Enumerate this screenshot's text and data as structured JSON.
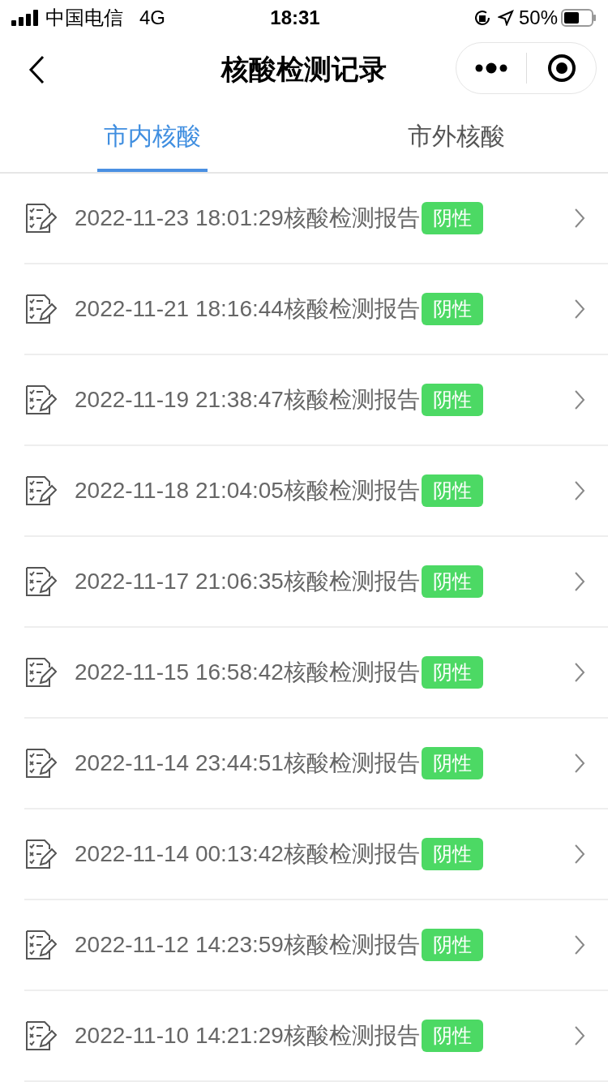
{
  "status_bar": {
    "carrier": "中国电信",
    "network": "4G",
    "time": "18:31",
    "battery": "50%"
  },
  "nav": {
    "title": "核酸检测记录"
  },
  "tabs": [
    {
      "label": "市内核酸",
      "selected": true
    },
    {
      "label": "市外核酸",
      "selected": false
    }
  ],
  "records": [
    {
      "title": "2022-11-23 18:01:29核酸检测报告",
      "result": "阴性"
    },
    {
      "title": "2022-11-21 18:16:44核酸检测报告",
      "result": "阴性"
    },
    {
      "title": "2022-11-19 21:38:47核酸检测报告",
      "result": "阴性"
    },
    {
      "title": "2022-11-18 21:04:05核酸检测报告",
      "result": "阴性"
    },
    {
      "title": "2022-11-17 21:06:35核酸检测报告",
      "result": "阴性"
    },
    {
      "title": "2022-11-15 16:58:42核酸检测报告",
      "result": "阴性"
    },
    {
      "title": "2022-11-14 23:44:51核酸检测报告",
      "result": "阴性"
    },
    {
      "title": "2022-11-14 00:13:42核酸检测报告",
      "result": "阴性"
    },
    {
      "title": "2022-11-12 14:23:59核酸检测报告",
      "result": "阴性"
    },
    {
      "title": "2022-11-10 14:21:29核酸检测报告",
      "result": "阴性"
    }
  ]
}
